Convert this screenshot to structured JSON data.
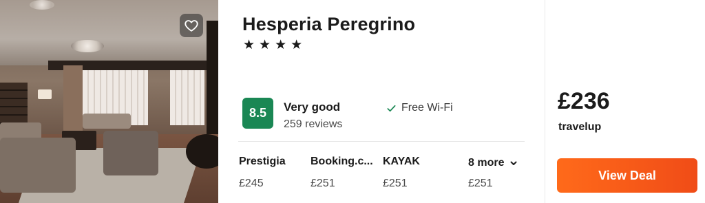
{
  "hotel": {
    "name": "Hesperia Peregrino",
    "stars": [
      "★",
      "★",
      "★",
      "★"
    ],
    "score": "8.5",
    "rating_label": "Very good",
    "reviews": "259 reviews",
    "amenity": "Free Wi-Fi"
  },
  "providers": [
    {
      "name": "Prestigia",
      "price": "£245"
    },
    {
      "name": "Booking.c...",
      "price": "£251"
    },
    {
      "name": "KAYAK",
      "price": "£251"
    }
  ],
  "more": {
    "label": "8 more",
    "price": "£251"
  },
  "deal": {
    "price": "£236",
    "seller": "travelup",
    "button_label": "View Deal"
  },
  "colors": {
    "score_bg": "#1a8754",
    "deal_button": "#f35a18",
    "check": "#1a8754"
  },
  "icons": {
    "favorite": "heart-outline-icon",
    "amenity": "check-icon",
    "more": "chevron-down-icon"
  }
}
